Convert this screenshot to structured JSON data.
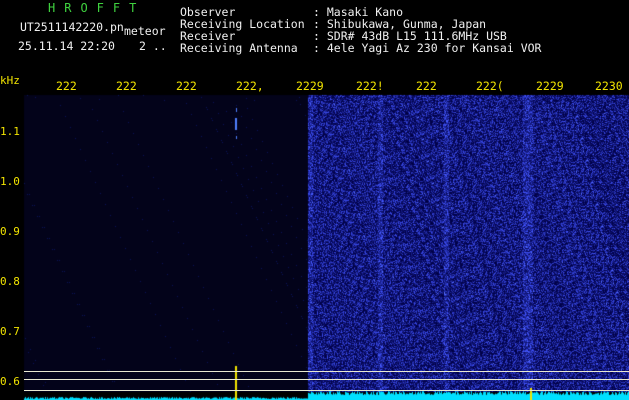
{
  "header": {
    "brand": "HROFFT",
    "filename": "UT2511142220.pn",
    "tag": "meteor",
    "datetime": "25.11.14 22:20",
    "counter": "2 ..",
    "observer_label": "Observer",
    "location_label": "Receiving Location",
    "receiver_label": "Receiver",
    "antenna_label": "Receiving Antenna",
    "observer_value": ": Masaki Kano",
    "location_value": ": Shibukawa, Gunma, Japan",
    "receiver_value": ": SDR# 43dB L15 111.6MHz USB",
    "antenna_value": ": 4ele Yagi Az 230 for Kansai VOR"
  },
  "axis": {
    "unit": "kHz",
    "y_ticks": [
      "1.1",
      "1.0",
      "0.9",
      "0.8",
      "0.7",
      "0.6"
    ],
    "x_ticks": [
      "222",
      "222",
      "222",
      "222,",
      "2229",
      "222!",
      "222",
      "222(",
      "2229",
      "2230"
    ]
  },
  "colors": {
    "label": "#f2e400",
    "signal": "#1133cc",
    "trace": "#00e0ff",
    "brand": "#3fd23f"
  }
}
